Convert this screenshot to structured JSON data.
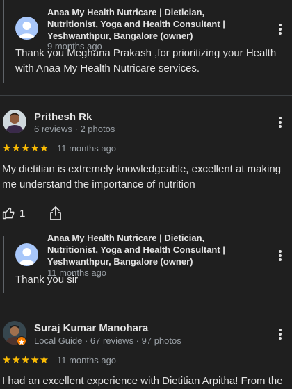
{
  "reply1": {
    "owner_name": "Anaa My Health Nutricare | Dietician, Nutritionist, Yoga and Health Consultant | Yeshwanthpur, Bangalore (owner)",
    "time": "9 months ago",
    "text": "Thank you Meghana Prakash ,for prioritizing your Health with Anaa My Health Nutricare services."
  },
  "review1": {
    "name": "Prithesh Rk",
    "sub": "6 reviews · 2 photos",
    "stars": "★★★★★",
    "rating": 5,
    "time": "11 months ago",
    "text": "My dietitian is extremely knowledgeable, excellent at making me understand the importance of nutrition",
    "like_count": "1"
  },
  "reply2": {
    "owner_name": "Anaa My Health Nutricare | Dietician, Nutritionist, Yoga and Health Consultant | Yeshwanthpur, Bangalore (owner)",
    "time": "11 months ago",
    "text": "Thank you sir"
  },
  "review2": {
    "name": "Suraj Kumar Manohara",
    "sub": "Local Guide · 67 reviews · 97 photos",
    "stars": "★★★★★",
    "rating": 5,
    "time": "11 months ago",
    "text": "I had an excellent experience with Dietitian Arpitha! From the"
  },
  "icons": {
    "like": "thumbs-up-icon",
    "share": "share-icon",
    "more": "more-vert-icon",
    "local_guide": "local-guide-badge-icon"
  },
  "colors": {
    "background": "#1f1f1f",
    "star": "#fbbc04",
    "owner_avatar": "#a8c7fa",
    "local_guide_badge": "#f57c00"
  }
}
